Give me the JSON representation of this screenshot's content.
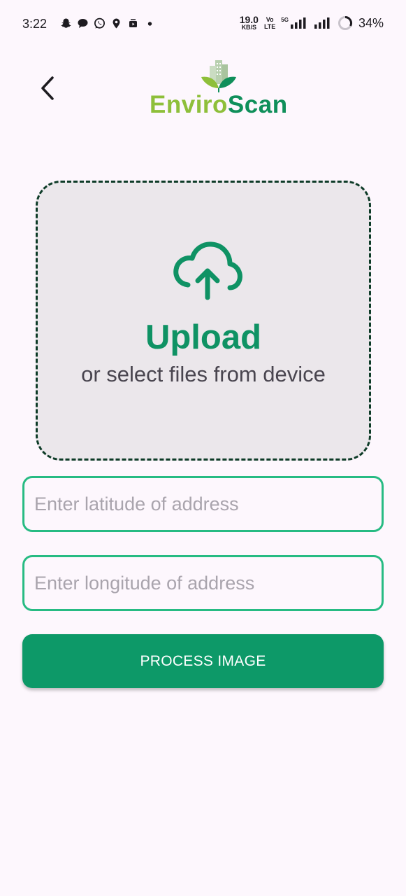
{
  "status_bar": {
    "time": "3:22",
    "net_speed_value": "19.0",
    "net_speed_unit": "KB/S",
    "volte_top": "Vo",
    "volte_bottom": "LTE",
    "network_label": "5G",
    "battery_percent": "34%"
  },
  "header": {
    "logo_part1": "Enviro",
    "logo_part2": "Scan"
  },
  "upload": {
    "title": "Upload",
    "subtitle": "or select files from device"
  },
  "form": {
    "latitude_placeholder": "Enter latitude of address",
    "latitude_value": "",
    "longitude_placeholder": "Enter longitude of address",
    "longitude_value": "",
    "submit_label": "PROCESS IMAGE"
  },
  "colors": {
    "accent": "#0d9968",
    "input_border": "#27bb83",
    "logo_green_light": "#8ebf3a",
    "logo_green_dark": "#0f8f5a",
    "upload_border": "#0d3b27",
    "background": "#fdf7fd"
  },
  "icons": {
    "back": "arrow-left-icon",
    "upload": "cloud-upload-icon"
  }
}
